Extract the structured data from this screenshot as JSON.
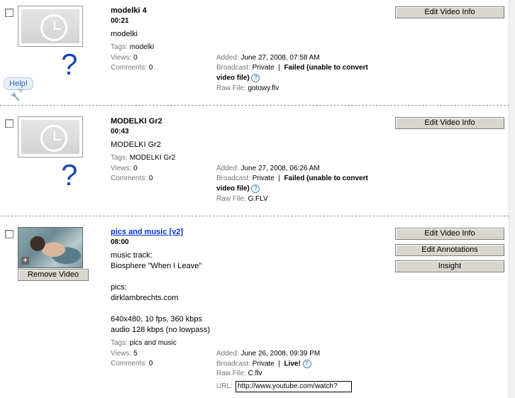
{
  "help_bubble": "Help!",
  "videos": [
    {
      "title": "modelki 4",
      "duration": "00:21",
      "description": "modelki",
      "tags_label": "Tags:",
      "tags": "modelki",
      "views_label": "Views:",
      "views": "0",
      "comments_label": "Comments:",
      "comments": "0",
      "added_label": "Added:",
      "added": "June 27, 2008, 07:58 AM",
      "broadcast_label": "Broadcast:",
      "broadcast": "Private",
      "status_1": "Failed (unable to convert",
      "status_2": "video file)",
      "rawfile_label": "Raw File:",
      "rawfile": "gotowy.flv",
      "buttons": [
        "Edit Video Info"
      ]
    },
    {
      "title": "MODELKI Gr2",
      "duration": "00:43",
      "description": "MODELKI Gr2",
      "tags_label": "Tags:",
      "tags": "MODELKI Gr2",
      "views_label": "Views:",
      "views": "0",
      "comments_label": "Comments:",
      "comments": "0",
      "added_label": "Added:",
      "added": "June 27, 2008, 06:26 AM",
      "broadcast_label": "Broadcast:",
      "broadcast": "Private",
      "status_1": "Failed (unable to convert",
      "status_2": "video file)",
      "rawfile_label": "Raw File:",
      "rawfile": "G.FLV",
      "buttons": [
        "Edit Video Info"
      ]
    },
    {
      "title": "pics and music [v2]",
      "duration": "08:00",
      "description": "music track:\nBiosphere \"When I Leave\"\n\npics:\ndirklambrechts.com\n\n640x480, 10 fps, 360 kbps\naudio 128 kbps (no lowpass)",
      "tags_label": "Tags:",
      "tags": "pics and music",
      "views_label": "Views:",
      "views": "5",
      "comments_label": "Comments:",
      "comments": "0",
      "added_label": "Added:",
      "added": "June 26, 2008, 09:39 PM",
      "broadcast_label": "Broadcast:",
      "broadcast": "Private",
      "status_1": "Live!",
      "rawfile_label": "Raw File:",
      "rawfile": "C.flv",
      "url_label": "URL:",
      "url": "http://www.youtube.com/watch?",
      "remove_label": "Remove Video",
      "buttons": [
        "Edit Video Info",
        "Edit Annotations",
        "Insight"
      ]
    }
  ],
  "colors": {
    "link": "#0033cc",
    "help_icon": "#3d8ac6",
    "question_mark": "#1848b8",
    "button_bg": "#d9d6cf"
  }
}
